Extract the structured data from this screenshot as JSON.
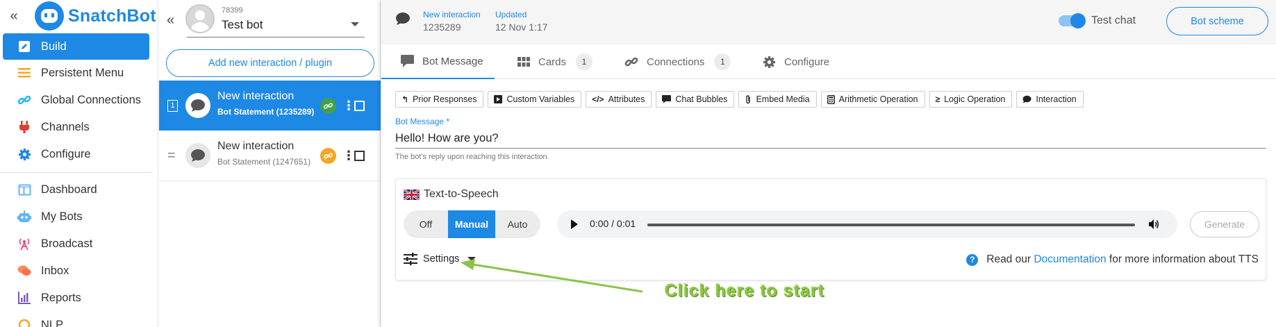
{
  "brand": {
    "name": "SnatchBot"
  },
  "nav": {
    "items": [
      {
        "label": "Build",
        "icon": "edit-icon",
        "active": true
      },
      {
        "label": "Persistent Menu",
        "icon": "menu-icon"
      },
      {
        "label": "Global Connections",
        "icon": "link-icon"
      },
      {
        "label": "Channels",
        "icon": "plug-icon"
      },
      {
        "label": "Configure",
        "icon": "gear-icon"
      },
      {
        "label": "Dashboard",
        "icon": "dashboard-icon"
      },
      {
        "label": "My Bots",
        "icon": "robot-icon"
      },
      {
        "label": "Broadcast",
        "icon": "broadcast-icon"
      },
      {
        "label": "Inbox",
        "icon": "chat-icon"
      },
      {
        "label": "Reports",
        "icon": "chart-icon"
      },
      {
        "label": "NLP",
        "icon": "nlp-icon"
      }
    ]
  },
  "bot": {
    "id": "78399",
    "name": "Test bot"
  },
  "interactions": {
    "add_label": "Add new interaction / plugin",
    "rows": [
      {
        "number": "1",
        "title": "New interaction",
        "subtitle": "Bot Statement (1235289)",
        "selected": true,
        "link_color": "#43a047"
      },
      {
        "number": "",
        "title": "New interaction",
        "subtitle": "Bot Statement (1247651)",
        "selected": false,
        "link_color": "#f5a623"
      }
    ]
  },
  "header": {
    "interaction_label": "New interaction",
    "interaction_id": "1235289",
    "updated_label": "Updated",
    "updated_value": "12 Nov 1:17",
    "test_chat_label": "Test chat",
    "test_chat_on": true,
    "scheme_label": "Bot scheme"
  },
  "tabs": [
    {
      "label": "Bot Message",
      "icon": "message-icon",
      "active": true
    },
    {
      "label": "Cards",
      "icon": "grid-icon",
      "badge": "1"
    },
    {
      "label": "Connections",
      "icon": "link-icon",
      "badge": "1"
    },
    {
      "label": "Configure",
      "icon": "gear-icon"
    }
  ],
  "toolbar": [
    {
      "label": "Prior Responses",
      "icon": "reply-icon"
    },
    {
      "label": "Custom Variables",
      "icon": "play-box-icon"
    },
    {
      "label": "Attributes",
      "icon": "code-icon"
    },
    {
      "label": "Chat Bubbles",
      "icon": "comment-icon"
    },
    {
      "label": "Embed Media",
      "icon": "paperclip-icon"
    },
    {
      "label": "Arithmetic Operation",
      "icon": "calculator-icon"
    },
    {
      "label": "Logic Operation",
      "icon": "greater-equal-icon"
    },
    {
      "label": "Interaction",
      "icon": "speech-bubble-icon"
    }
  ],
  "message": {
    "label": "Bot Message *",
    "value": "Hello! How are you?",
    "hint": "The bot's reply upon reaching this interaction."
  },
  "tts": {
    "title": "Text-to-Speech",
    "modes": [
      "Off",
      "Manual",
      "Auto"
    ],
    "selected_mode": "Manual",
    "time": "0:00 / 0:01",
    "generate_label": "Generate",
    "settings_label": "Settings",
    "doc_prefix": "Read our",
    "doc_link": "Documentation",
    "doc_suffix": "for more information about TTS"
  },
  "annotation": {
    "text": "Click here to start"
  },
  "colors": {
    "accent": "#1e88e5",
    "annotation": "#8bc34a"
  }
}
